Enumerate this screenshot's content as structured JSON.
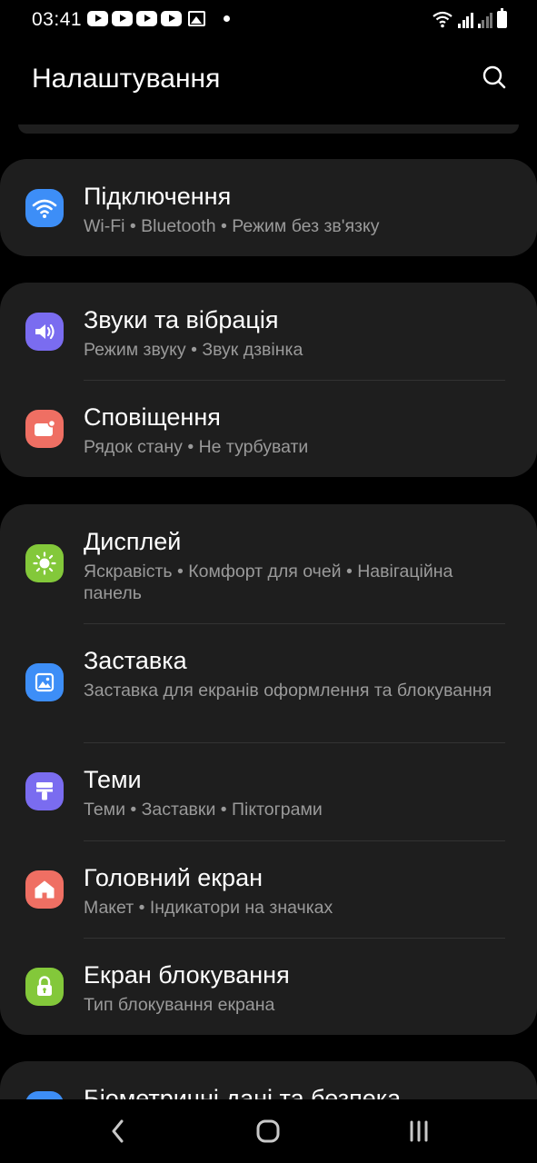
{
  "status_bar": {
    "time": "03:41",
    "notification_icons": [
      "youtube-icon",
      "youtube-icon",
      "youtube-icon",
      "youtube-icon",
      "gallery-icon",
      "dot-icon"
    ],
    "system_icons": [
      "wifi-icon",
      "signal-icon",
      "signal-icon",
      "battery-icon"
    ]
  },
  "header": {
    "title": "Налаштування",
    "search_icon": "search-icon"
  },
  "groups": [
    {
      "items": [
        {
          "title": "Підключення",
          "subtitle": "Wi-Fi  •  Bluetooth  •  Режим без зв'язку",
          "icon": "wifi-icon",
          "color": "#3d8ef7"
        }
      ]
    },
    {
      "items": [
        {
          "title": "Звуки та вібрація",
          "subtitle": "Режим звуку  •  Звук дзвінка",
          "icon": "volume-icon",
          "color": "#7a6cf0"
        },
        {
          "title": "Сповіщення",
          "subtitle": "Рядок стану  •  Не турбувати",
          "icon": "notification-icon",
          "color": "#ef6f63"
        }
      ]
    },
    {
      "items": [
        {
          "title": "Дисплей",
          "subtitle": "Яскравість  •  Комфорт для очей  •  Навігаційна панель",
          "icon": "brightness-icon",
          "color": "#83c83a"
        },
        {
          "title": "Заставка",
          "subtitle": "Заставка для екранів оформлення та блокування",
          "icon": "wallpaper-icon",
          "color": "#3d8ef7"
        },
        {
          "title": "Теми",
          "subtitle": "Теми  •  Заставки  •  Піктограми",
          "icon": "theme-brush-icon",
          "color": "#7a6cf0"
        },
        {
          "title": "Головний екран",
          "subtitle": "Макет  •  Індикатори на значках",
          "icon": "home-icon",
          "color": "#ef6f63"
        },
        {
          "title": "Екран блокування",
          "subtitle": "Тип блокування екрана",
          "icon": "lock-icon",
          "color": "#83c83a"
        }
      ]
    },
    {
      "items": [
        {
          "title": "Біометричні дані та безпека",
          "icon": "shield-icon",
          "color": "#3d8ef7"
        }
      ]
    }
  ],
  "nav_bar": {
    "back_icon": "back-icon",
    "home_icon": "home-button-icon",
    "recents_icon": "recents-icon"
  }
}
